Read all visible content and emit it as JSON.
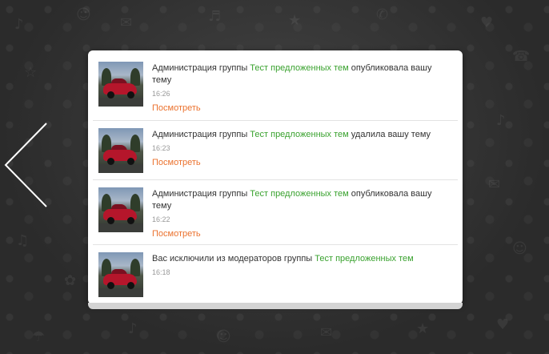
{
  "navigation": {
    "prev_icon": "chevron-left-icon"
  },
  "notifications": [
    {
      "prefix": "Администрация группы ",
      "group": "Тест предложенных тем",
      "suffix": " опубликовала вашу тему",
      "time": "16:26",
      "action": "Посмотреть"
    },
    {
      "prefix": "Администрация группы ",
      "group": "Тест предложенных тем",
      "suffix": " удалила вашу тему",
      "time": "16:23",
      "action": "Посмотреть"
    },
    {
      "prefix": "Администрация группы ",
      "group": "Тест предложенных тем",
      "suffix": " опубликовала вашу тему",
      "time": "16:22",
      "action": "Посмотреть"
    },
    {
      "prefix": "Вас исключили из модераторов группы ",
      "group": "Тест предложенных тем",
      "suffix": "",
      "time": "16:18",
      "action": ""
    }
  ],
  "colors": {
    "group_link": "#3aa22f",
    "action_link": "#eb722e",
    "timestamp": "#999999"
  }
}
